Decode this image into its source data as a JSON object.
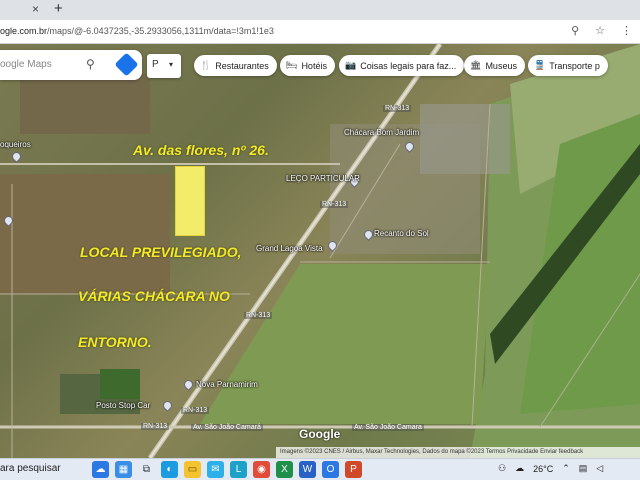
{
  "browser": {
    "tab_close": "×",
    "new_tab": "+",
    "url_host": "ogle.com.br",
    "url_path": "/maps/@-6.0437235,-35.2933056,1311m/data=!3m1!1e3",
    "icons": [
      "location-icon",
      "star-icon",
      "menu-icon"
    ]
  },
  "maps": {
    "search_placeholder": "oogle Maps",
    "pin_select": "P",
    "pin_caret": "▾",
    "chips": [
      {
        "icon": "restaurant-icon",
        "glyph": "🍴",
        "label": "Restaurantes"
      },
      {
        "icon": "hotel-icon",
        "glyph": "🛏",
        "label": "Hotéis"
      },
      {
        "icon": "camera-icon",
        "glyph": "📷",
        "label": "Coisas legais para faz..."
      },
      {
        "icon": "museum-icon",
        "glyph": "🏛",
        "label": "Museus"
      },
      {
        "icon": "transit-icon",
        "glyph": "🚆",
        "label": "Transporte p"
      }
    ],
    "place_labels": {
      "left": "oqueiros",
      "chacara_bom": "Chácara Bom Jardim",
      "particular": "LEÇO PARTICULAR",
      "grand": "Grand Lagoa Vista",
      "recanto": "Recanto do Sol",
      "nova": "Nova Parnamirim",
      "posto": "Posto Stop Car"
    },
    "road_labels": {
      "rn313_top": "RN-313",
      "rn313_mid": "RN-313",
      "rn313_low": "RN-313",
      "rn313_bottom": "RN-313",
      "rn314": "RN-313",
      "av_sao_joao": "Av. São João Camará",
      "av_sao_joao_2": "Av. São João Camara"
    },
    "google_logo": "Google",
    "attribution": "Imagens ©2023 CNES / Airbus, Maxar Technologies, Dados do mapa ©2023   Termos   Privacidade   Enviar feedback"
  },
  "overlay": {
    "address": "Av. das flores, nº 26.",
    "line1": "LOCAL PREVILEGIADO,",
    "line2": "VÁRIAS CHÁCARA NO",
    "line3": "ENTORNO."
  },
  "taskbar": {
    "search": "ara pesquisar",
    "weather": "26°C"
  }
}
